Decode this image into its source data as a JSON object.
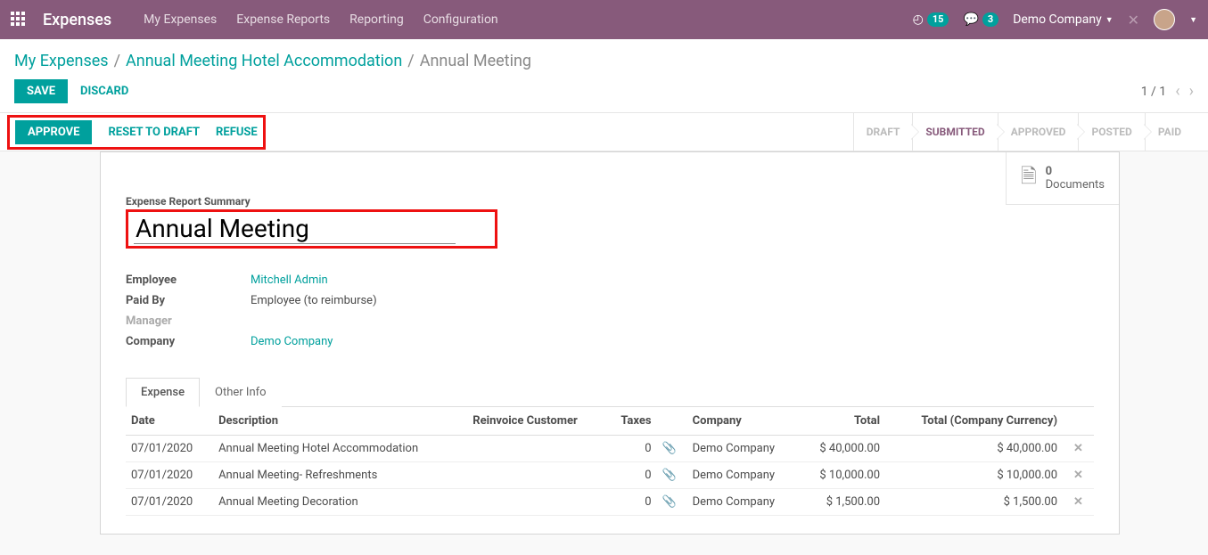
{
  "nav": {
    "brand": "Expenses",
    "menu": [
      "My Expenses",
      "Expense Reports",
      "Reporting",
      "Configuration"
    ],
    "activity_count": "15",
    "msg_count": "3",
    "company": "Demo Company"
  },
  "breadcrumb": {
    "root": "My Expenses",
    "parent": "Annual Meeting Hotel Accommodation",
    "current": "Annual Meeting"
  },
  "edit": {
    "save": "SAVE",
    "discard": "DISCARD",
    "pager": "1 / 1"
  },
  "actions": {
    "approve": "APPROVE",
    "reset": "RESET TO DRAFT",
    "refuse": "REFUSE"
  },
  "status": {
    "steps": [
      "DRAFT",
      "SUBMITTED",
      "APPROVED",
      "POSTED",
      "PAID"
    ],
    "active_index": 1
  },
  "docbox": {
    "count": "0",
    "label": "Documents"
  },
  "form": {
    "summary_label": "Expense Report Summary",
    "summary_value": "Annual Meeting",
    "employee_k": "Employee",
    "employee_v": "Mitchell Admin",
    "paidby_k": "Paid By",
    "paidby_v": "Employee (to reimburse)",
    "manager_k": "Manager",
    "manager_v": "",
    "company_k": "Company",
    "company_v": "Demo Company"
  },
  "tabs": {
    "expense": "Expense",
    "other": "Other Info"
  },
  "table": {
    "headers": {
      "date": "Date",
      "desc": "Description",
      "reinv": "Reinvoice Customer",
      "taxes": "Taxes",
      "company": "Company",
      "total": "Total",
      "total_cc": "Total (Company Currency)"
    },
    "rows": [
      {
        "date": "07/01/2020",
        "desc": "Annual Meeting Hotel Accommodation",
        "att": "0",
        "company": "Demo Company",
        "total": "$ 40,000.00",
        "total_cc": "$ 40,000.00"
      },
      {
        "date": "07/01/2020",
        "desc": "Annual Meeting- Refreshments",
        "att": "0",
        "company": "Demo Company",
        "total": "$ 10,000.00",
        "total_cc": "$ 10,000.00"
      },
      {
        "date": "07/01/2020",
        "desc": "Annual Meeting Decoration",
        "att": "0",
        "company": "Demo Company",
        "total": "$ 1,500.00",
        "total_cc": "$ 1,500.00"
      }
    ]
  }
}
